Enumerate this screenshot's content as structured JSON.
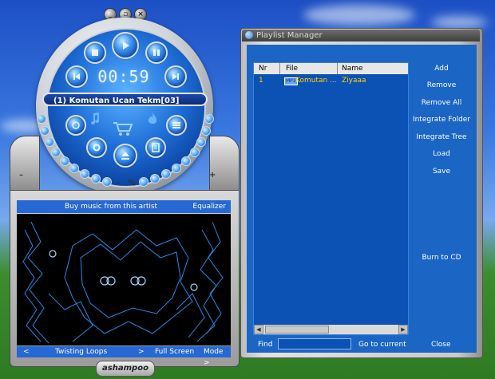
{
  "player": {
    "time": "00:59",
    "track_title": "(1) Komutan Ucan Tekm[03]",
    "volume_minus": "–",
    "volume_percent": "%",
    "volume_plus": "+",
    "vis_header": {
      "buy": "Buy music from this artist",
      "equalizer": "Equalizer"
    },
    "vis_footer": {
      "prev": "<",
      "preset": "Twisting Loops",
      "next": ">",
      "fullscreen": "Full Screen",
      "mode": "Mode >"
    },
    "logo": "ashampoo"
  },
  "playlist": {
    "title": "Playlist Manager",
    "columns": {
      "nr": "Nr",
      "file": "File",
      "name": "Name"
    },
    "rows": [
      {
        "nr": "1",
        "file_badge": "MP3",
        "file": "Komutan ...",
        "name": "Ziyaaa"
      }
    ],
    "buttons": {
      "add": "Add",
      "remove": "Remove",
      "remove_all": "Remove All",
      "integrate_folder": "Integrate Folder",
      "integrate_tree": "Integrate Tree",
      "load": "Load",
      "save": "Save",
      "burn": "Burn to CD"
    },
    "find_label": "Find",
    "find_value": "",
    "go_to_current": "Go to current",
    "close": "Close"
  },
  "colors": {
    "panel_blue": "#1b65c5",
    "accent_yellow": "#ffd200",
    "vis_bg": "#000000"
  }
}
